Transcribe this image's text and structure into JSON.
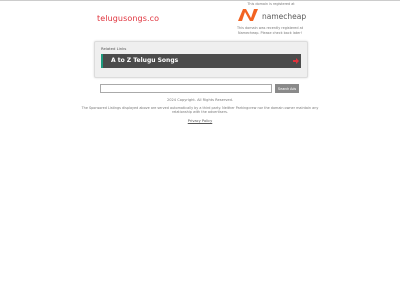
{
  "header": {
    "domain": "telugusongs.co",
    "registered_note": "This domain is registered at",
    "registrar_name": "namecheap",
    "registrar_note": "This domain was recently registered at Namecheap. Please check back later!"
  },
  "related": {
    "heading": "Related Links",
    "items": [
      {
        "label": "A to Z Telugu Songs"
      }
    ]
  },
  "search": {
    "value": "",
    "button_label": "Search Ads"
  },
  "footer": {
    "copyright": "2024 Copyright. All Rights Reserved.",
    "disclaimer": "The Sponsored Listings displayed above are served automatically by a third party. Neither Parkingcrew nor the domain owner maintain any relationship with the advertisers.",
    "privacy": "Privacy Policy"
  },
  "colors": {
    "brand": "#e0323c",
    "namecheap_orange": "#f26322",
    "link_bar": "#4b4b4b",
    "accent": "#1c9b7e",
    "arrow": "#e0323c"
  }
}
